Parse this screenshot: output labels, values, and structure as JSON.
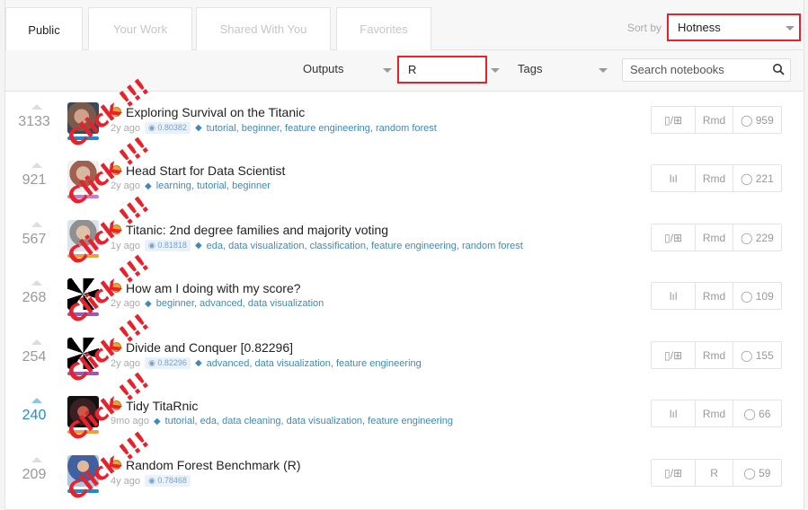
{
  "tabs": [
    {
      "label": "Public",
      "active": true
    },
    {
      "label": "Your Work",
      "active": false
    },
    {
      "label": "Shared With You",
      "active": false
    },
    {
      "label": "Favorites",
      "active": false
    }
  ],
  "sort": {
    "label": "Sort by",
    "value": "Hotness"
  },
  "filters": {
    "outputs_label": "Outputs",
    "language_value": "R",
    "tags_label": "Tags",
    "search_placeholder": "Search notebooks"
  },
  "annotation_text": "Click !!!",
  "colors": {
    "highlight_border": "#e8212a",
    "accent": "#1c8bd4",
    "tag": "#3d8ab8",
    "medal": "#e9a23b"
  },
  "kernels": [
    {
      "votes": "3133",
      "title": "Exploring Survival on the Titanic",
      "age": "2y ago",
      "score": "0.80382",
      "tags": "tutorial, beginner, feature engineering, random forest",
      "output_icon": "▯/⊞",
      "lang": "Rmd",
      "comments": "959",
      "vote_highlight": false
    },
    {
      "votes": "921",
      "title": "Head Start for Data Scientist",
      "age": "2y ago",
      "score": "",
      "tags": "learning, tutorial, beginner",
      "output_icon": "lıl",
      "lang": "Rmd",
      "comments": "221",
      "vote_highlight": false
    },
    {
      "votes": "567",
      "title": "Titanic: 2nd degree families and majority voting",
      "age": "1y ago",
      "score": "0.81818",
      "tags": "eda, data visualization, classification, feature engineering, random forest",
      "output_icon": "▯/⊞",
      "lang": "Rmd",
      "comments": "229",
      "vote_highlight": false
    },
    {
      "votes": "268",
      "title": "How am I doing with my score?",
      "age": "2y ago",
      "score": "",
      "tags": "beginner, advanced, data visualization",
      "output_icon": "lıl",
      "lang": "Rmd",
      "comments": "109",
      "vote_highlight": false
    },
    {
      "votes": "254",
      "title": "Divide and Conquer [0.82296]",
      "age": "2y ago",
      "score": "0.82296",
      "tags": "advanced, data visualization, feature engineering",
      "output_icon": "▯/⊞",
      "lang": "Rmd",
      "comments": "155",
      "vote_highlight": false
    },
    {
      "votes": "240",
      "title": "Tidy TitaRnic",
      "age": "9mo ago",
      "score": "",
      "tags": "tutorial, eda, data cleaning, data visualization, feature engineering",
      "output_icon": "lıl",
      "lang": "Rmd",
      "comments": "66",
      "vote_highlight": true
    },
    {
      "votes": "209",
      "title": "Random Forest Benchmark (R)",
      "age": "4y ago",
      "score": "0.78468",
      "tags": "",
      "output_icon": "▯/⊞",
      "lang": "R",
      "comments": "59",
      "vote_highlight": false
    }
  ]
}
